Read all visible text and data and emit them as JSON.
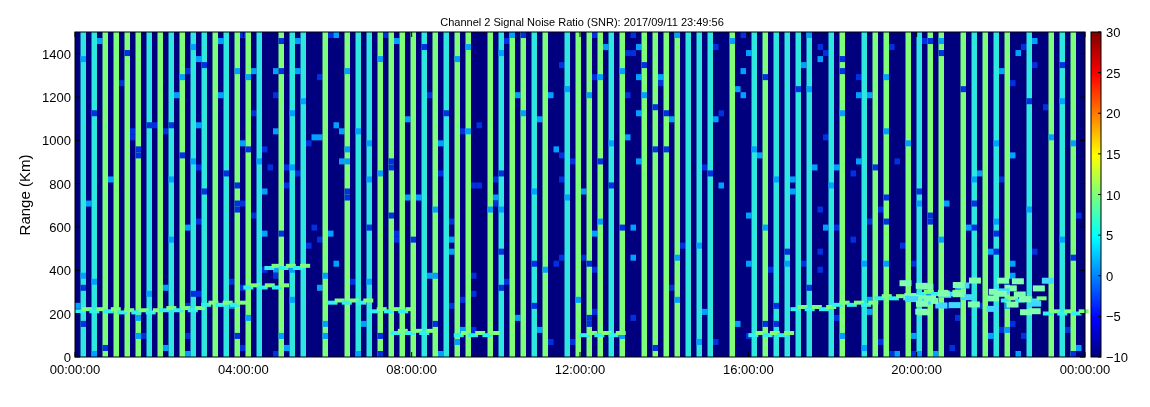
{
  "title": "Channel 2 Signal Noise Ratio (SNR): 2017/09/11 23:49:56",
  "ylabel": "Range (Km)",
  "yticks": [
    "1400",
    "1200",
    "1000",
    "800",
    "600",
    "400",
    "200",
    "0"
  ],
  "xticks": [
    "00:00:00",
    "04:00:00",
    "08:00:00",
    "12:00:00",
    "16:00:00",
    "20:00:00",
    "00:00:00"
  ],
  "colorbar_ticks": [
    "30",
    "25",
    "20",
    "15",
    "10",
    "5",
    "0",
    "−5",
    "−10"
  ]
}
